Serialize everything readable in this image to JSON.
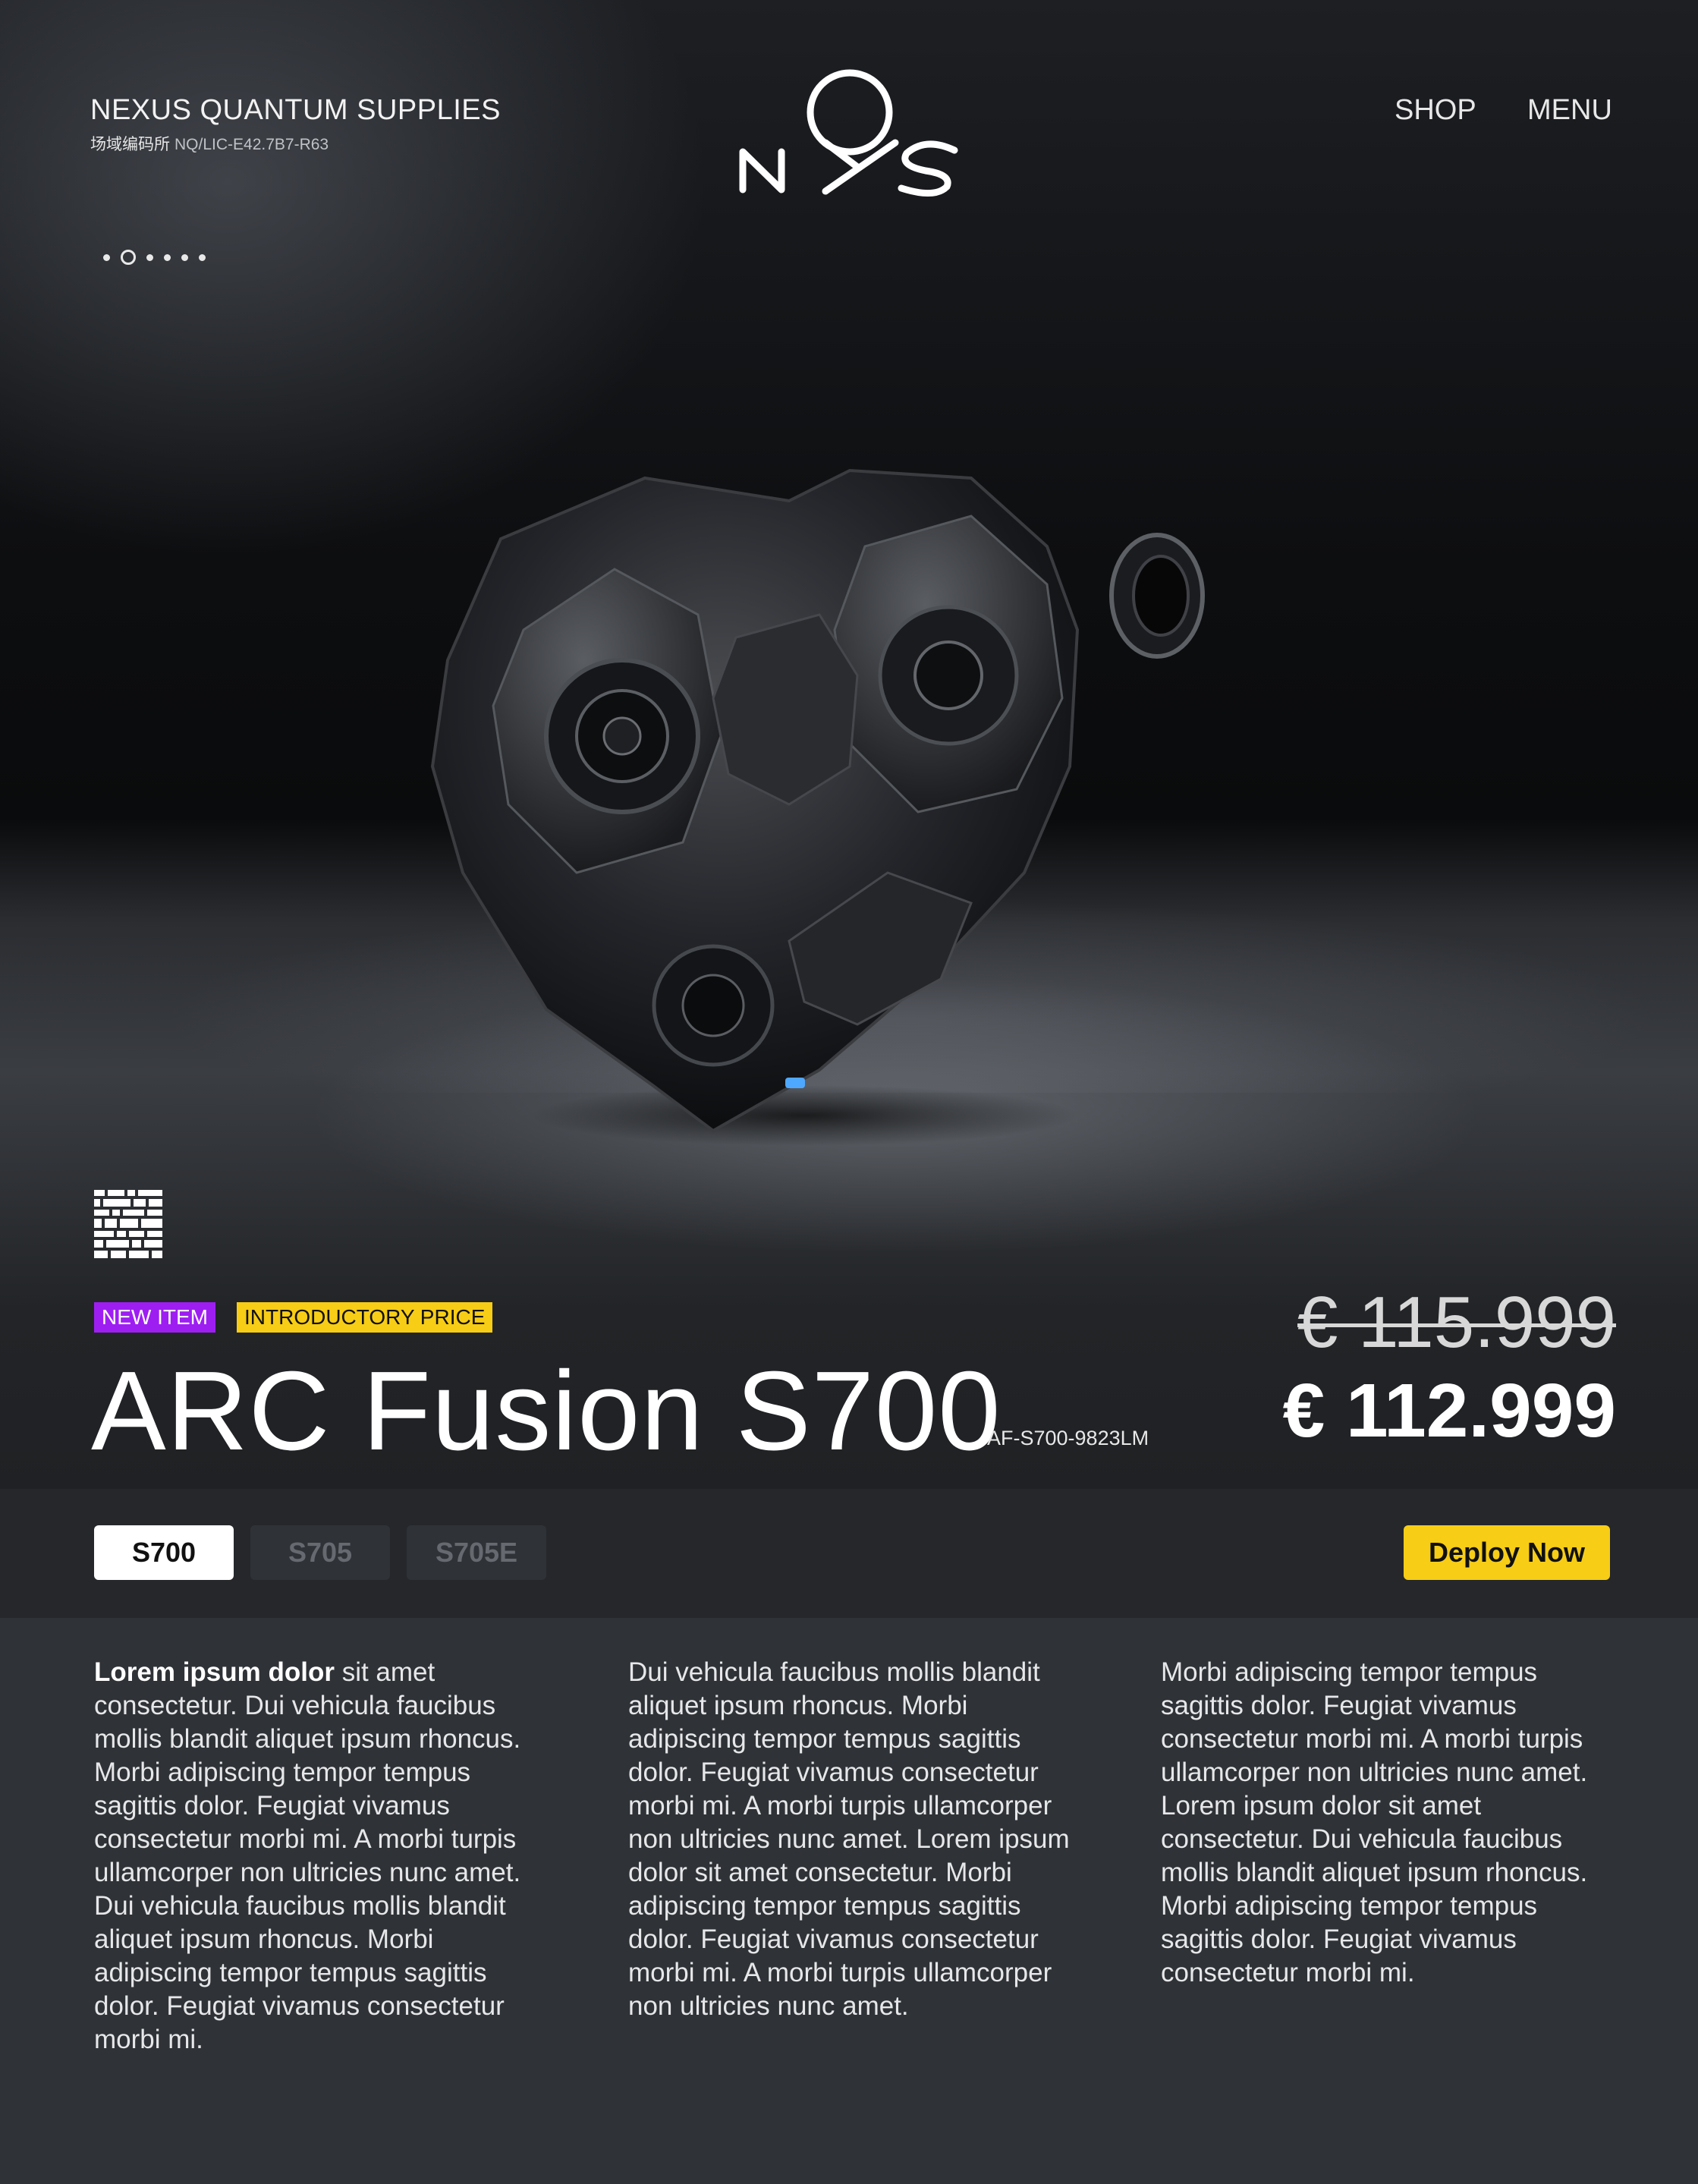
{
  "brand": {
    "name": "NEXUS QUANTUM SUPPLIES",
    "code_cjk": "场域编码所",
    "code": "NQ/LIC-E42.7B7-R63",
    "logo_text": "nQs"
  },
  "nav": {
    "shop": "SHOP",
    "menu": "MENU"
  },
  "carousel": {
    "count": 6,
    "active_index": 1
  },
  "product": {
    "badges": {
      "new": "NEW ITEM",
      "intro": "INTRODUCTORY PRICE"
    },
    "title": "ARC Fusion S700",
    "sku": "AF-S700-9823LM",
    "old_price": "€ 115.999",
    "price": "€ 112.999",
    "image": "mechanical-sphere-device",
    "qr_icon": "qr-code-icon"
  },
  "variants": {
    "items": [
      "S700",
      "S705",
      "S705E"
    ],
    "selected": "S700"
  },
  "cta": {
    "deploy": "Deploy Now"
  },
  "colors": {
    "accent_yellow": "#f7cd16",
    "accent_purple": "#9e1ef2",
    "background": "#2f3236"
  },
  "description": {
    "col1_bold": "Lorem ipsum dolor",
    "col1_rest": " sit amet consectetur. Dui vehicula faucibus mollis blandit aliquet ipsum rhoncus. Morbi adipiscing tempor tempus sagittis dolor. Feugiat vivamus consectetur morbi mi. A morbi turpis ullamcorper non ultricies  nunc amet. Dui vehicula faucibus mollis blandit aliquet ipsum rhoncus. Morbi adipiscing tempor tempus sagittis dolor. Feugiat vivamus consectetur morbi mi.",
    "col2": "Dui vehicula faucibus mollis blandit aliquet ipsum rhoncus. Morbi adipiscing tempor tempus sagittis dolor. Feugiat vivamus consectetur morbi mi. A morbi turpis ullamcorper non ultricies  nunc amet. Lorem ipsum dolor sit amet consectetur. Morbi adipiscing tempor tempus sagittis dolor. Feugiat vivamus consectetur morbi mi. A morbi turpis ullamcorper non ultricies  nunc amet.",
    "col3": "Morbi adipiscing tempor tempus sagittis dolor. Feugiat vivamus consectetur morbi mi. A morbi turpis ullamcorper non ultricies nunc amet. Lorem ipsum dolor sit amet consectetur. Dui vehicula faucibus mollis blandit aliquet ipsum rhoncus. Morbi adipiscing tempor tempus sagittis dolor. Feugiat vivamus consectetur morbi mi."
  }
}
